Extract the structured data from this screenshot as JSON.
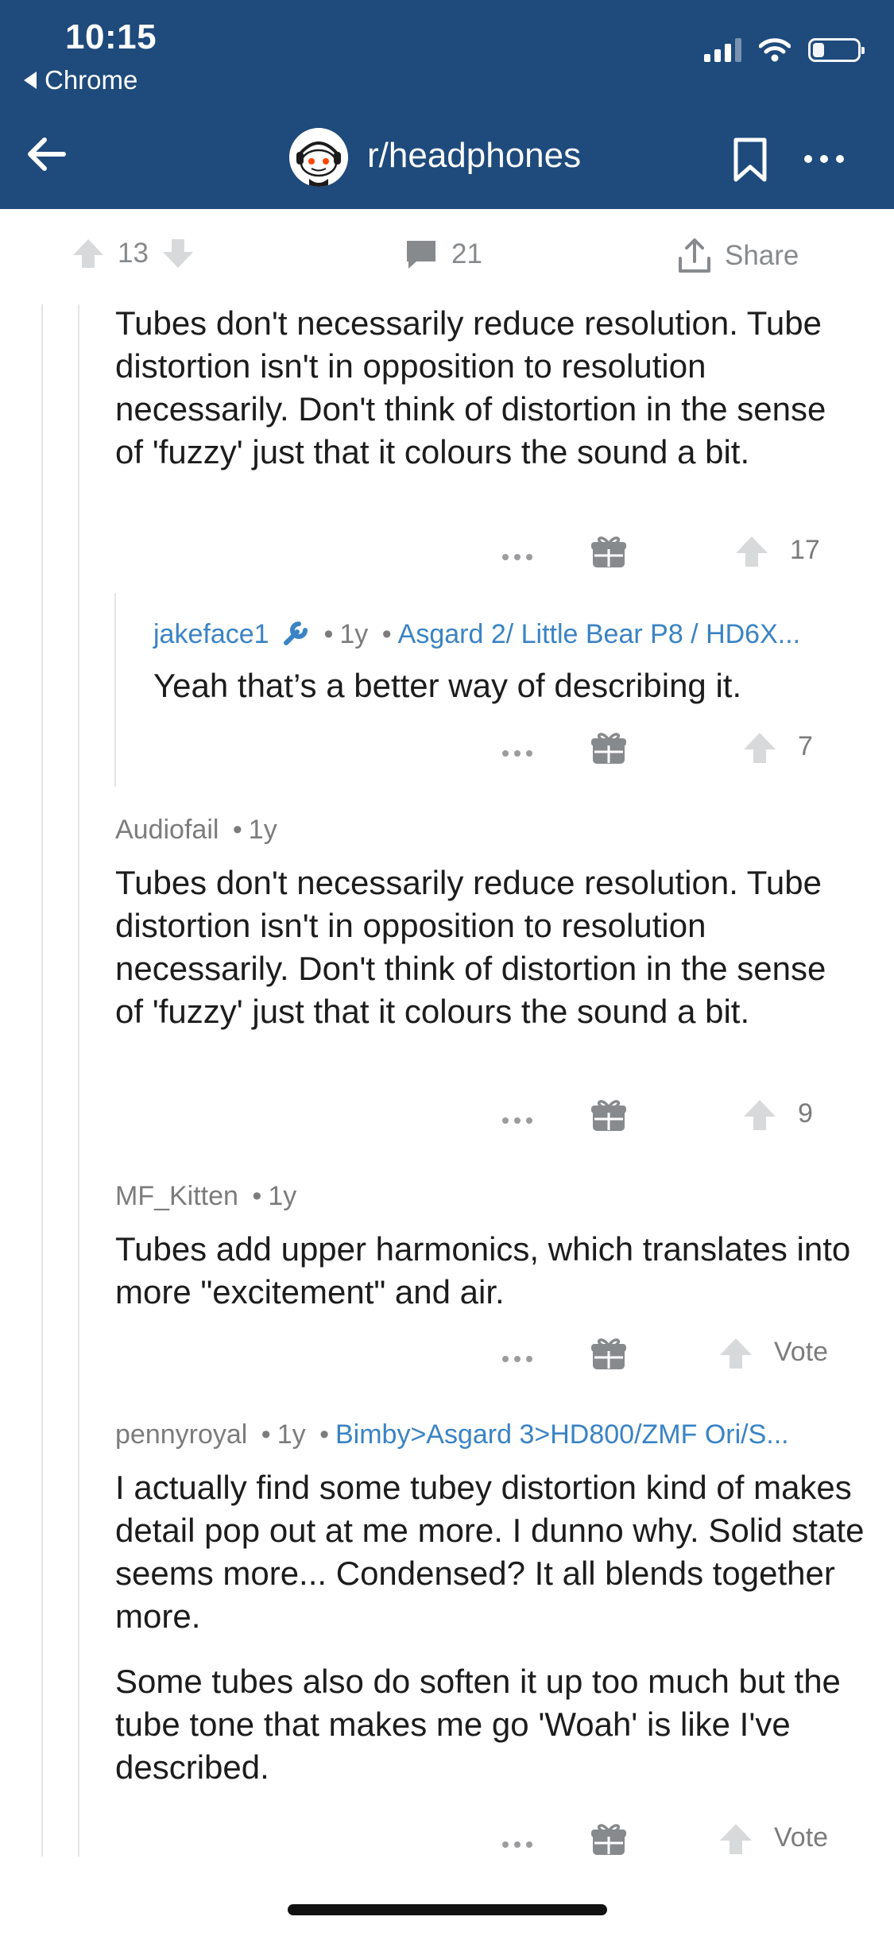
{
  "status_bar": {
    "time": "10:15",
    "back_app": "Chrome"
  },
  "header": {
    "subreddit": "r/headphones",
    "icons": [
      "back-arrow-icon",
      "snoo-avatar-icon",
      "bookmark-icon",
      "more-icon"
    ]
  },
  "post_actions": {
    "score": "13",
    "comments": "21",
    "share": "Share"
  },
  "comments": [
    {
      "body": [
        "Tubes don't necessarily reduce resolution. Tube distortion isn't in opposition to resolution necessarily. Don't think of distortion in the sense of 'fuzzy' just that it colours the sound a bit."
      ],
      "score": "17"
    },
    {
      "author": "jakeface1",
      "age": "1y",
      "flair": "Asgard 2/ Little Bear P8 / HD6X...",
      "body": [
        "Yeah that’s a better way of describing it."
      ],
      "score": "7"
    },
    {
      "author": "Audiofail",
      "age": "1y",
      "body": [
        "Tubes don't necessarily reduce resolution. Tube distortion isn't in opposition to resolution necessarily. Don't think of distortion in the sense of 'fuzzy' just that it colours the sound a bit."
      ],
      "score": "9"
    },
    {
      "author": "MF_Kitten",
      "age": "1y",
      "body": [
        "Tubes add upper harmonics, which translates into more \"excitement\" and air."
      ],
      "score": "Vote"
    },
    {
      "author": "pennyroyal",
      "age": "1y",
      "flair": "Bimby>Asgard 3>HD800/ZMF Ori/S...",
      "body": [
        "I actually find some tubey distortion kind of makes detail pop out at me more. I dunno why. Solid state seems more... Condensed? It all blends together more.",
        "Some tubes also do soften it up too much but the tube tone that makes me go 'Woah' is like I've described."
      ],
      "score": "Vote"
    }
  ],
  "colors": {
    "header_bg": "#1e4a7c",
    "link": "#3a83c4",
    "muted": "#7c7c7c"
  }
}
